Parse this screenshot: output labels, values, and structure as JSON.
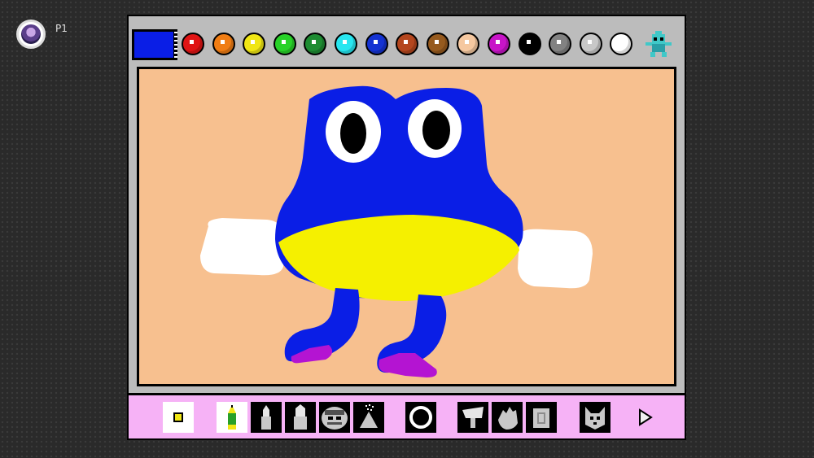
{
  "player": {
    "label": "P1",
    "avatar_icon": "kirby-mage-avatar-icon"
  },
  "palette": {
    "selected_color": "#0a1ee6",
    "colors": [
      {
        "name": "red",
        "hex": "#e01414"
      },
      {
        "name": "orange",
        "hex": "#f07d14"
      },
      {
        "name": "yellow",
        "hex": "#f0e614"
      },
      {
        "name": "green",
        "hex": "#28d228"
      },
      {
        "name": "dark-green",
        "hex": "#1e8c32"
      },
      {
        "name": "cyan",
        "hex": "#28e6f0"
      },
      {
        "name": "blue",
        "hex": "#1432d2"
      },
      {
        "name": "red-brown",
        "hex": "#b4461e"
      },
      {
        "name": "brown",
        "hex": "#965a1e"
      },
      {
        "name": "peach",
        "hex": "#f5c8a0"
      },
      {
        "name": "magenta",
        "hex": "#c814c8"
      },
      {
        "name": "black",
        "hex": "#000000"
      },
      {
        "name": "gray",
        "hex": "#828282"
      },
      {
        "name": "light-gray",
        "hex": "#c8c8c8"
      },
      {
        "name": "white",
        "hex": "#ffffff"
      }
    ],
    "mascot_icon": "gnat-mascot-icon"
  },
  "canvas": {
    "background": "#f7c08f",
    "subject": "blue-frog-drawing"
  },
  "toolbar": {
    "tools": [
      {
        "name": "brush-size-tool",
        "icon": "small-square-icon",
        "style": "white"
      },
      {
        "name": "pencil-tool",
        "icon": "pencil-icon",
        "style": "white"
      },
      {
        "name": "paint-brush-tool",
        "icon": "paint-brush-icon",
        "style": "dark"
      },
      {
        "name": "wide-brush-tool",
        "icon": "wide-brush-icon",
        "style": "dark"
      },
      {
        "name": "stamp-tool",
        "icon": "mario-stamp-icon",
        "style": "dark"
      },
      {
        "name": "spray-can-tool",
        "icon": "spray-can-icon",
        "style": "dark"
      },
      {
        "name": "shape-tool",
        "icon": "circle-icon",
        "style": "dark"
      },
      {
        "name": "fill-tool",
        "icon": "paint-bucket-icon",
        "style": "dark"
      },
      {
        "name": "undo-tool",
        "icon": "hand-icon",
        "style": "dark"
      },
      {
        "name": "eraser-tool",
        "icon": "eraser-icon",
        "style": "dark"
      },
      {
        "name": "clear-tool",
        "icon": "dog-icon",
        "style": "dark"
      },
      {
        "name": "next-page-arrow",
        "icon": "right-arrow-icon",
        "style": "none"
      }
    ]
  }
}
